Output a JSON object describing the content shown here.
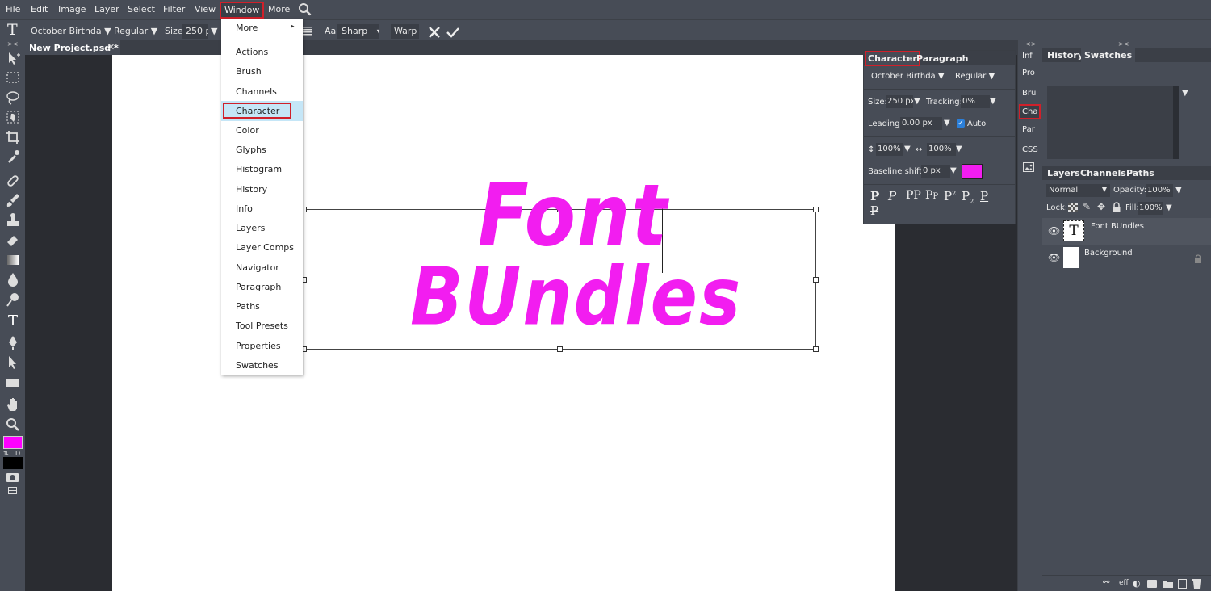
{
  "menubar": {
    "items": [
      "File",
      "Edit",
      "Image",
      "Layer",
      "Select",
      "Filter",
      "View",
      "Window",
      "More"
    ],
    "search_icon": "search-icon"
  },
  "optionsbar": {
    "tool_icon": "T",
    "font_family": "October Birthda",
    "font_style": "Regular",
    "size_label": "Size:",
    "size_value": "250 px",
    "aa_label": "Aa:",
    "aa_value": "Sharp",
    "warp_label": "Warp",
    "cancel_icon": "close-icon",
    "commit_icon": "check-icon"
  },
  "document": {
    "tab_title": "New Project.psd *",
    "tab_close": "✕",
    "text_line1": "Font",
    "text_line2": "BUndles",
    "text_color": "#f21df0"
  },
  "window_menu": {
    "items": [
      "More",
      "Actions",
      "Brush",
      "Channels",
      "Character",
      "Color",
      "Glyphs",
      "Histogram",
      "History",
      "Info",
      "Layers",
      "Layer Comps",
      "Navigator",
      "Paragraph",
      "Paths",
      "Tool Presets",
      "Properties",
      "Swatches"
    ],
    "highlighted": "Character",
    "submenu_arrow": "▸"
  },
  "character_panel": {
    "tabs": [
      "Character",
      "Paragraph"
    ],
    "font_family": "October Birthda ▼",
    "font_style": "Regular ▼",
    "size_label": "Size:",
    "size_value": "250 px",
    "tracking_label": "Tracking:",
    "tracking_value": "0%",
    "leading_label": "Leading:",
    "leading_value": "0.00 px",
    "auto_label": "Auto",
    "vscale_value": "100%",
    "hscale_value": "100%",
    "baseline_label": "Baseline shift:",
    "baseline_value": "0 px",
    "color": "#f21df0"
  },
  "right_strip": {
    "items": [
      "Inf",
      "Pro",
      "Bru",
      "Cha",
      "Par",
      "CSS"
    ]
  },
  "history_panel": {
    "tabs": [
      "History",
      "Swatches"
    ],
    "swatches": [
      "#ff00ff",
      "#ffffff",
      "#ff0000",
      "#00ff44",
      "#0040ff",
      "#00ffff",
      "#ffff33",
      "#000000",
      "#888888",
      "#ffffff"
    ]
  },
  "layers_panel": {
    "tabs": [
      "Layers",
      "Channels",
      "Paths"
    ],
    "blend_mode": "Normal",
    "opacity_label": "Opacity:",
    "opacity_value": "100%",
    "lock_label": "Lock:",
    "fill_label": "Fill:",
    "fill_value": "100%",
    "layers": [
      {
        "name": "Font BUndles",
        "thumb": "T"
      },
      {
        "name": "Background",
        "thumb": ""
      }
    ],
    "footer_eff": "eff"
  },
  "colors": {
    "foreground": "#ff00ff",
    "background": "#000000"
  }
}
